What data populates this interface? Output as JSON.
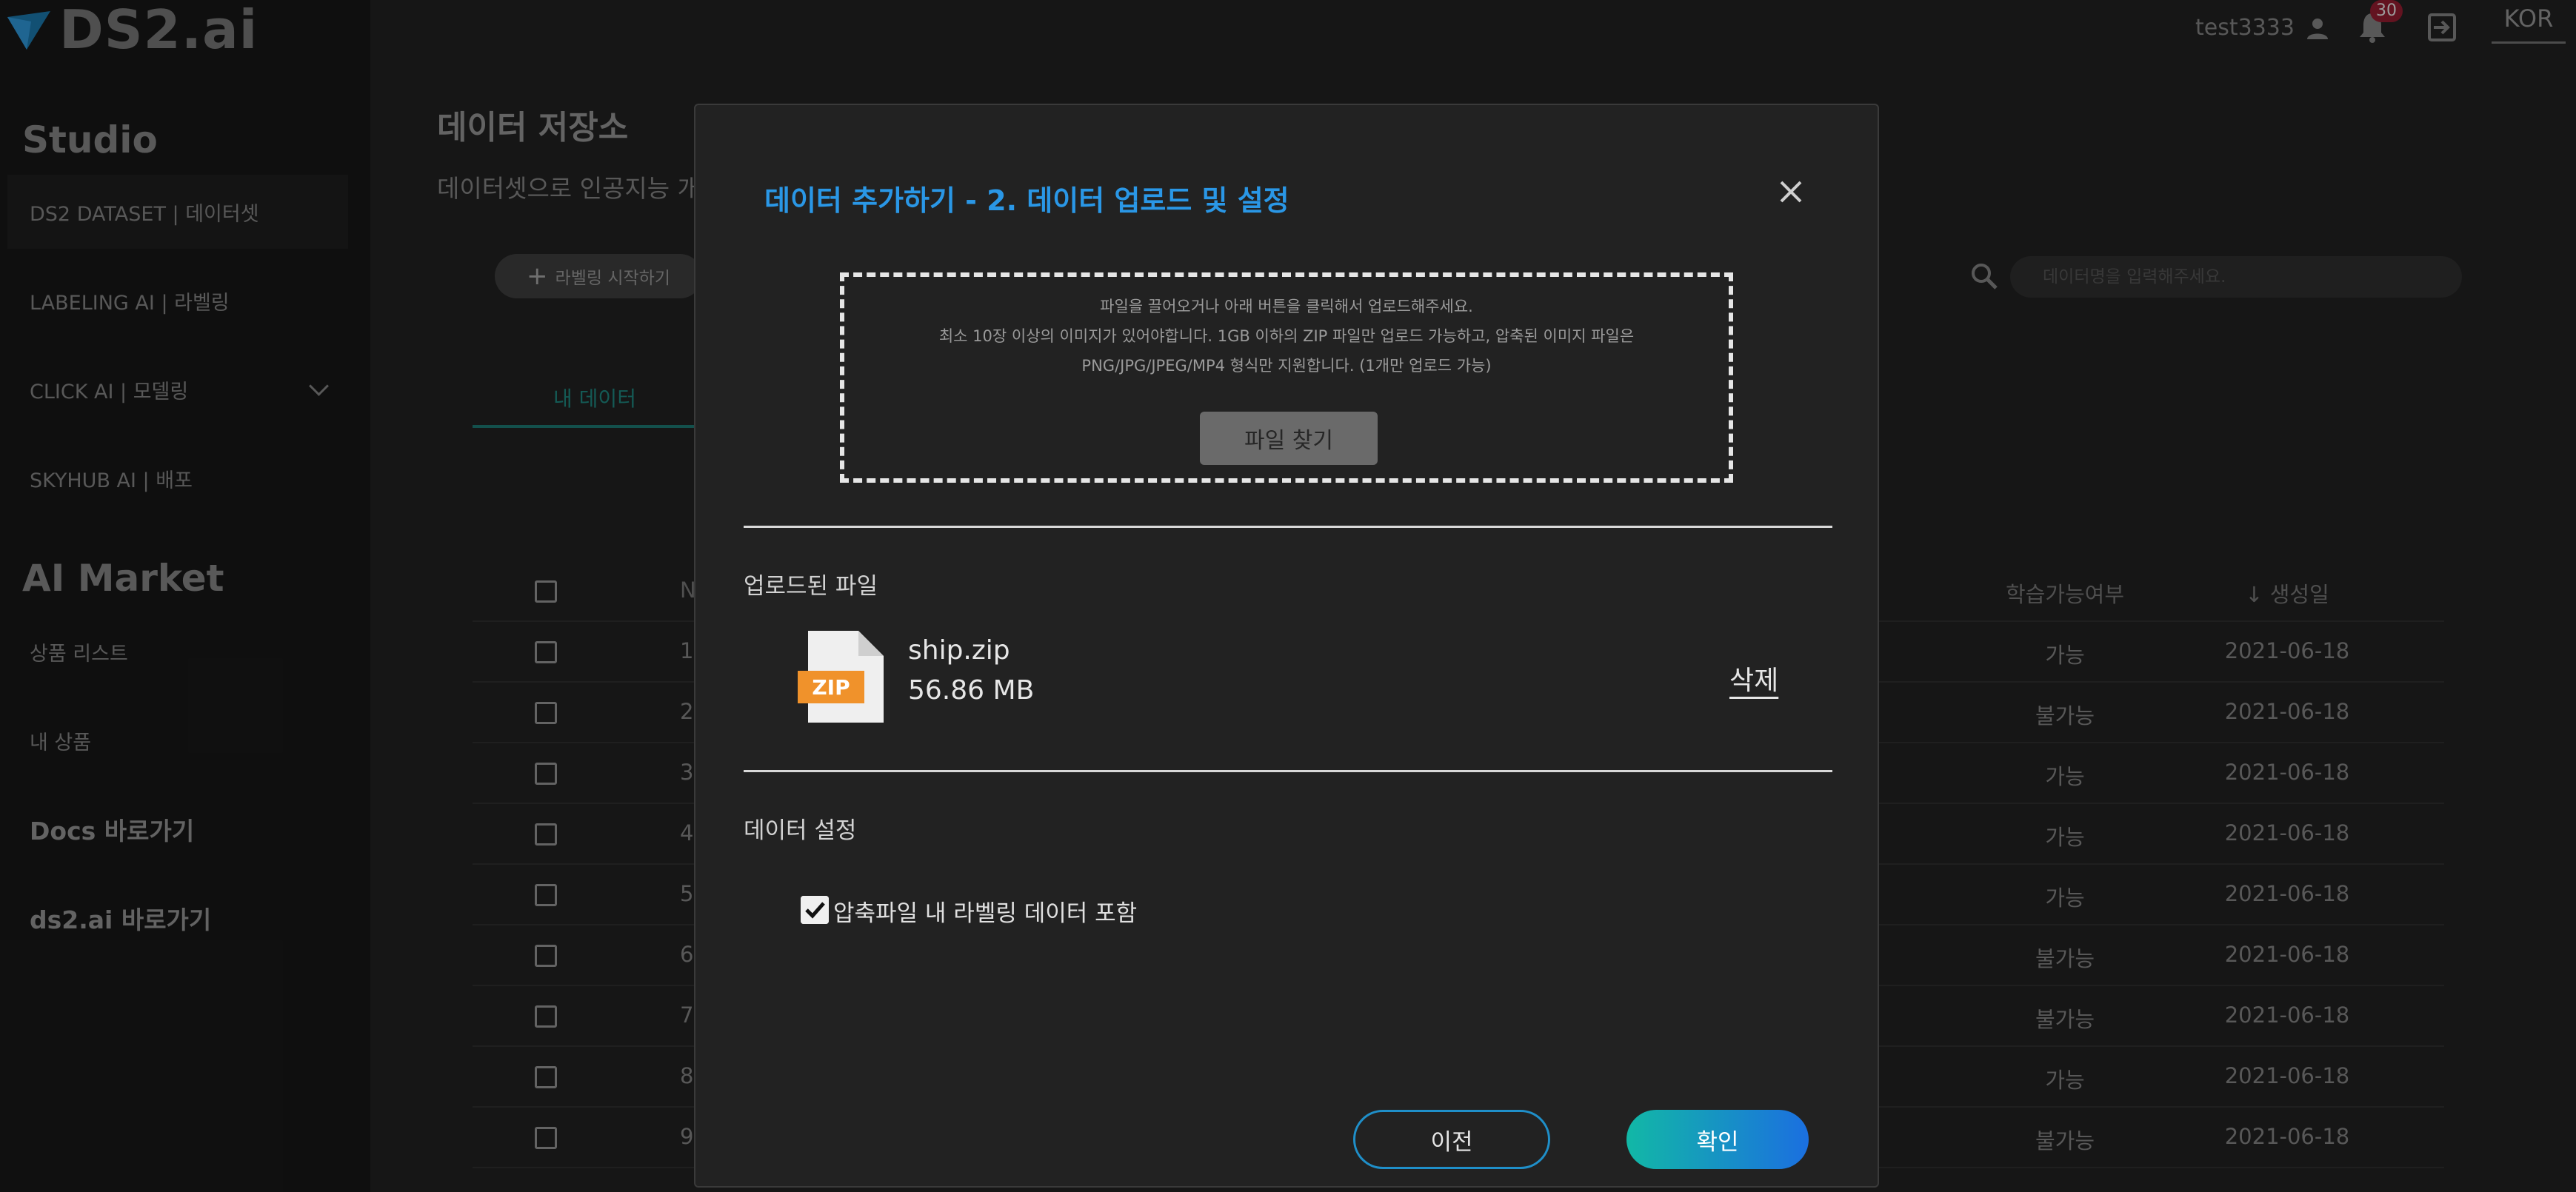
{
  "brand": {
    "logo_text": "DS2.ai"
  },
  "sidebar": {
    "studio_title": "Studio",
    "studio_items": [
      {
        "label": "DS2 DATASET | 데이터셋",
        "active": true
      },
      {
        "label": "LABELING AI | 라벨링"
      },
      {
        "label": "CLICK AI | 모델링"
      },
      {
        "label": "SKYHUB AI | 배포"
      }
    ],
    "market_title": "AI Market",
    "market_items": [
      {
        "label": "상품 리스트"
      },
      {
        "label": "내 상품"
      }
    ],
    "docs_link": "Docs 바로가기",
    "site_link": "ds2.ai 바로가기"
  },
  "header": {
    "username": "test3333",
    "notification_count": "30",
    "language": "KOR"
  },
  "main": {
    "title": "데이터 저장소",
    "subtitle": "데이터셋으로 인공지능 개",
    "start_labeling_label": "라벨링 시작하기",
    "tab_my_data": "내 데이터",
    "search_placeholder": "데이터명을 입력해주세요.",
    "table": {
      "col_no": "N",
      "col_trainable": "학습가능여부",
      "col_created": "생성일",
      "rows": [
        {
          "no": "1",
          "trainable": "가능",
          "created": "2021-06-18"
        },
        {
          "no": "2",
          "trainable": "불가능",
          "created": "2021-06-18"
        },
        {
          "no": "3",
          "trainable": "가능",
          "created": "2021-06-18"
        },
        {
          "no": "4",
          "trainable": "가능",
          "created": "2021-06-18"
        },
        {
          "no": "5",
          "trainable": "가능",
          "created": "2021-06-18"
        },
        {
          "no": "6",
          "trainable": "불가능",
          "created": "2021-06-18"
        },
        {
          "no": "7",
          "trainable": "불가능",
          "created": "2021-06-18"
        },
        {
          "no": "8",
          "trainable": "가능",
          "created": "2021-06-18"
        },
        {
          "no": "9",
          "trainable": "불가능",
          "created": "2021-06-18"
        }
      ]
    }
  },
  "modal": {
    "title": "데이터 추가하기 - 2. 데이터 업로드 및 설정",
    "dropzone": {
      "line1": "파일을 끌어오거나 아래 버튼을 클릭해서 업로드해주세요.",
      "line2": "최소 10장 이상의 이미지가 있어야합니다. 1GB 이하의 ZIP 파일만 업로드 가능하고, 압축된 이미지 파일은",
      "line3": "PNG/JPG/JPEG/MP4 형식만 지원합니다. (1개만 업로드 가능)",
      "browse_label": "파일 찾기"
    },
    "uploaded_section_label": "업로드된 파일",
    "file": {
      "icon_label": "ZIP",
      "name": "ship.zip",
      "size": "56.86 MB",
      "delete_label": "삭제"
    },
    "settings_section_label": "데이터 설정",
    "include_labels_text": "압축파일 내 라벨링 데이터 포함",
    "include_labels_checked": true,
    "prev_label": "이전",
    "confirm_label": "확인"
  },
  "colors": {
    "accent_blue": "#2a97e6",
    "teal": "#12b8a6",
    "button_gradient_end": "#1b6fe0",
    "zip_orange": "#f0922b"
  }
}
